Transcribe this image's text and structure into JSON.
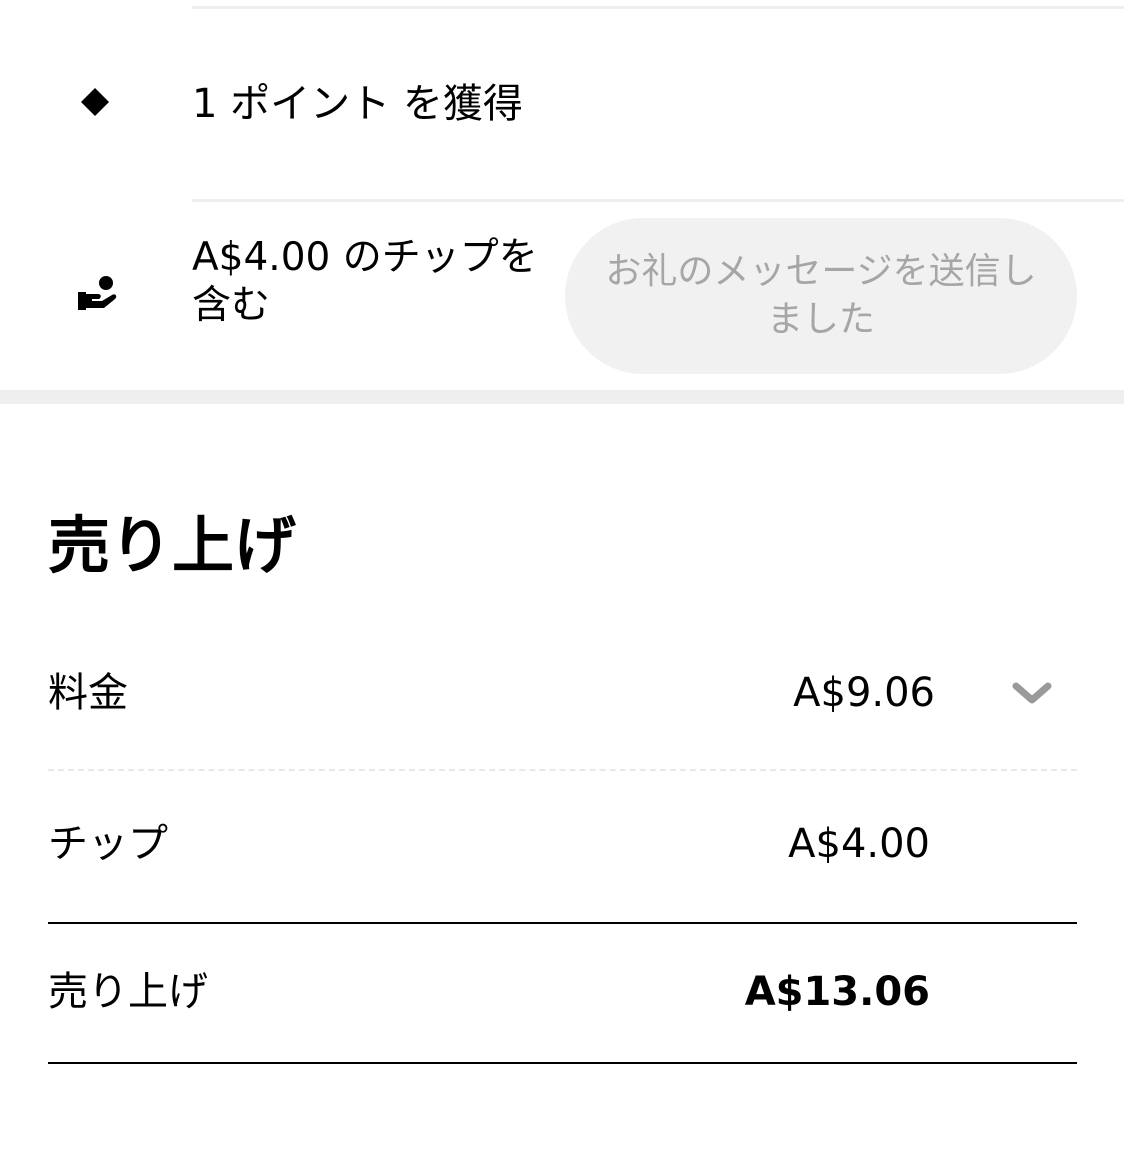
{
  "points_row": {
    "icon": "diamond-icon",
    "text": "1 ポイント を獲得"
  },
  "tip_row": {
    "icon": "hand-receiving-icon",
    "text": "A$4.00 のチップを含む",
    "thanks_button_label": "お礼のメッセージを送信しました"
  },
  "earnings": {
    "title": "売り上げ",
    "fare": {
      "label": "料金",
      "value": "A$9.06",
      "expand_icon": "chevron-down-icon"
    },
    "tip": {
      "label": "チップ",
      "value": "A$4.00"
    },
    "total": {
      "label": "売り上げ",
      "value": "A$13.06"
    }
  },
  "colors": {
    "text": "#000000",
    "muted_text": "#a6a6a6",
    "pill_background": "#f1f1f1",
    "divider": "#efefef"
  }
}
